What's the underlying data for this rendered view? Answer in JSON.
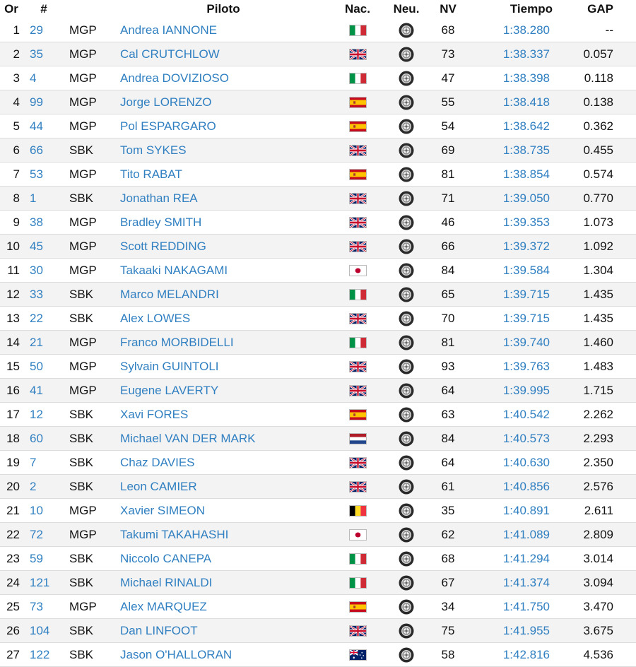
{
  "headers": {
    "or": "Or",
    "num": "#",
    "piloto": "Piloto",
    "nac": "Nac.",
    "neu": "Neu.",
    "nv": "NV",
    "tiempo": "Tiempo",
    "gap": "GAP"
  },
  "flag_colors": {
    "italy": [
      "#009246",
      "#ffffff",
      "#ce2b37"
    ],
    "spain": [
      "#c60b1e",
      "#ffc400",
      "#c60b1e"
    ],
    "belgium": [
      "#000000",
      "#fdda24",
      "#ef3340"
    ],
    "netherlands": [
      "#ae1c28",
      "#ffffff",
      "#21468b"
    ],
    "japan": [
      "#ffffff",
      "#bc002d"
    ],
    "uk": [
      "#012169",
      "#ffffff",
      "#c8102e"
    ],
    "australia": [
      "#012169",
      "#ffffff",
      "#e4002b"
    ]
  },
  "tyre_icon": "tyre-icon",
  "rows": [
    {
      "or": "1",
      "num": "29",
      "cls": "MGP",
      "piloto": "Andrea IANNONE",
      "flag": "italy",
      "nv": "68",
      "tiempo": "1:38.280",
      "gap": "--"
    },
    {
      "or": "2",
      "num": "35",
      "cls": "MGP",
      "piloto": "Cal CRUTCHLOW",
      "flag": "uk",
      "nv": "73",
      "tiempo": "1:38.337",
      "gap": "0.057"
    },
    {
      "or": "3",
      "num": "4",
      "cls": "MGP",
      "piloto": "Andrea DOVIZIOSO",
      "flag": "italy",
      "nv": "47",
      "tiempo": "1:38.398",
      "gap": "0.118"
    },
    {
      "or": "4",
      "num": "99",
      "cls": "MGP",
      "piloto": "Jorge LORENZO",
      "flag": "spain",
      "nv": "55",
      "tiempo": "1:38.418",
      "gap": "0.138"
    },
    {
      "or": "5",
      "num": "44",
      "cls": "MGP",
      "piloto": "Pol ESPARGARO",
      "flag": "spain",
      "nv": "54",
      "tiempo": "1:38.642",
      "gap": "0.362"
    },
    {
      "or": "6",
      "num": "66",
      "cls": "SBK",
      "piloto": "Tom SYKES",
      "flag": "uk",
      "nv": "69",
      "tiempo": "1:38.735",
      "gap": "0.455"
    },
    {
      "or": "7",
      "num": "53",
      "cls": "MGP",
      "piloto": "Tito RABAT",
      "flag": "spain",
      "nv": "81",
      "tiempo": "1:38.854",
      "gap": "0.574"
    },
    {
      "or": "8",
      "num": "1",
      "cls": "SBK",
      "piloto": "Jonathan REA",
      "flag": "uk",
      "nv": "71",
      "tiempo": "1:39.050",
      "gap": "0.770"
    },
    {
      "or": "9",
      "num": "38",
      "cls": "MGP",
      "piloto": "Bradley SMITH",
      "flag": "uk",
      "nv": "46",
      "tiempo": "1:39.353",
      "gap": "1.073"
    },
    {
      "or": "10",
      "num": "45",
      "cls": "MGP",
      "piloto": "Scott REDDING",
      "flag": "uk",
      "nv": "66",
      "tiempo": "1:39.372",
      "gap": "1.092"
    },
    {
      "or": "11",
      "num": "30",
      "cls": "MGP",
      "piloto": "Takaaki NAKAGAMI",
      "flag": "japan",
      "nv": "84",
      "tiempo": "1:39.584",
      "gap": "1.304"
    },
    {
      "or": "12",
      "num": "33",
      "cls": "SBK",
      "piloto": "Marco MELANDRI",
      "flag": "italy",
      "nv": "65",
      "tiempo": "1:39.715",
      "gap": "1.435"
    },
    {
      "or": "13",
      "num": "22",
      "cls": "SBK",
      "piloto": "Alex LOWES",
      "flag": "uk",
      "nv": "70",
      "tiempo": "1:39.715",
      "gap": "1.435"
    },
    {
      "or": "14",
      "num": "21",
      "cls": "MGP",
      "piloto": "Franco MORBIDELLI",
      "flag": "italy",
      "nv": "81",
      "tiempo": "1:39.740",
      "gap": "1.460"
    },
    {
      "or": "15",
      "num": "50",
      "cls": "MGP",
      "piloto": "Sylvain GUINTOLI",
      "flag": "uk",
      "nv": "93",
      "tiempo": "1:39.763",
      "gap": "1.483"
    },
    {
      "or": "16",
      "num": "41",
      "cls": "MGP",
      "piloto": "Eugene LAVERTY",
      "flag": "uk",
      "nv": "64",
      "tiempo": "1:39.995",
      "gap": "1.715"
    },
    {
      "or": "17",
      "num": "12",
      "cls": "SBK",
      "piloto": "Xavi FORES",
      "flag": "spain",
      "nv": "63",
      "tiempo": "1:40.542",
      "gap": "2.262"
    },
    {
      "or": "18",
      "num": "60",
      "cls": "SBK",
      "piloto": "Michael VAN DER MARK",
      "flag": "netherlands",
      "nv": "84",
      "tiempo": "1:40.573",
      "gap": "2.293"
    },
    {
      "or": "19",
      "num": "7",
      "cls": "SBK",
      "piloto": "Chaz DAVIES",
      "flag": "uk",
      "nv": "64",
      "tiempo": "1:40.630",
      "gap": "2.350"
    },
    {
      "or": "20",
      "num": "2",
      "cls": "SBK",
      "piloto": "Leon CAMIER",
      "flag": "uk",
      "nv": "61",
      "tiempo": "1:40.856",
      "gap": "2.576"
    },
    {
      "or": "21",
      "num": "10",
      "cls": "MGP",
      "piloto": "Xavier SIMEON",
      "flag": "belgium",
      "nv": "35",
      "tiempo": "1:40.891",
      "gap": "2.611"
    },
    {
      "or": "22",
      "num": "72",
      "cls": "MGP",
      "piloto": "Takumi TAKAHASHI",
      "flag": "japan",
      "nv": "62",
      "tiempo": "1:41.089",
      "gap": "2.809"
    },
    {
      "or": "23",
      "num": "59",
      "cls": "SBK",
      "piloto": "Niccolo CANEPA",
      "flag": "italy",
      "nv": "68",
      "tiempo": "1:41.294",
      "gap": "3.014"
    },
    {
      "or": "24",
      "num": "121",
      "cls": "SBK",
      "piloto": "Michael RINALDI",
      "flag": "italy",
      "nv": "67",
      "tiempo": "1:41.374",
      "gap": "3.094"
    },
    {
      "or": "25",
      "num": "73",
      "cls": "MGP",
      "piloto": "Alex MARQUEZ",
      "flag": "spain",
      "nv": "34",
      "tiempo": "1:41.750",
      "gap": "3.470"
    },
    {
      "or": "26",
      "num": "104",
      "cls": "SBK",
      "piloto": "Dan LINFOOT",
      "flag": "uk",
      "nv": "75",
      "tiempo": "1:41.955",
      "gap": "3.675"
    },
    {
      "or": "27",
      "num": "122",
      "cls": "SBK",
      "piloto": "Jason O'HALLORAN",
      "flag": "australia",
      "nv": "58",
      "tiempo": "1:42.816",
      "gap": "4.536"
    }
  ]
}
